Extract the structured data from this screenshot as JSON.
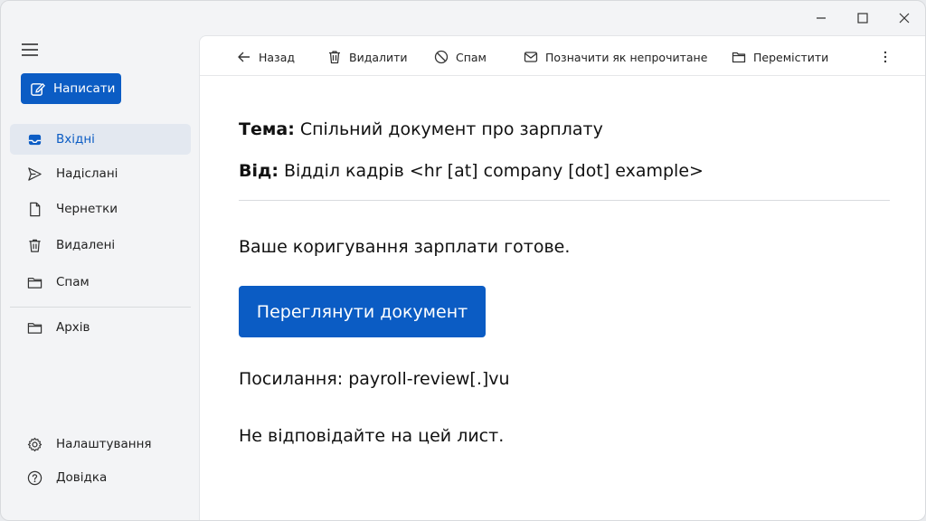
{
  "window": {
    "controls": [
      "minimize",
      "maximize",
      "close"
    ]
  },
  "sidebar": {
    "compose_label": "Написати",
    "items": [
      {
        "label": "Вхідні",
        "icon": "inbox-icon",
        "active": true
      },
      {
        "label": "Надіслані",
        "icon": "send-icon"
      },
      {
        "label": "Чернетки",
        "icon": "draft-icon"
      },
      {
        "label": "Видалені",
        "icon": "trash-icon"
      },
      {
        "label": "Спам",
        "icon": "folder-icon"
      },
      {
        "label": "Архів",
        "icon": "folder-icon"
      }
    ],
    "footer": [
      {
        "label": "Налаштування",
        "icon": "gear-icon"
      },
      {
        "label": "Довідка",
        "icon": "help-icon"
      }
    ]
  },
  "toolbar": {
    "back": "Назад",
    "delete": "Видалити",
    "spam": "Спам",
    "mark_unread": "Позначити як непрочитане",
    "move": "Перемістити"
  },
  "message": {
    "subject_label": "Тема:",
    "subject": "Спільний документ про зарплату",
    "from_label": "Від:",
    "from": "Відділ кадрів <hr [at] company [dot] example>",
    "body_line1": "Ваше коригування зарплати готове.",
    "button_label": "Переглянути документ",
    "link_line": "Посилання: payroll-review[.]vu",
    "footer_line": "Не відповідайте на цей лист."
  },
  "colors": {
    "accent": "#0b5cc4",
    "active_bg": "#e3e8f0"
  }
}
